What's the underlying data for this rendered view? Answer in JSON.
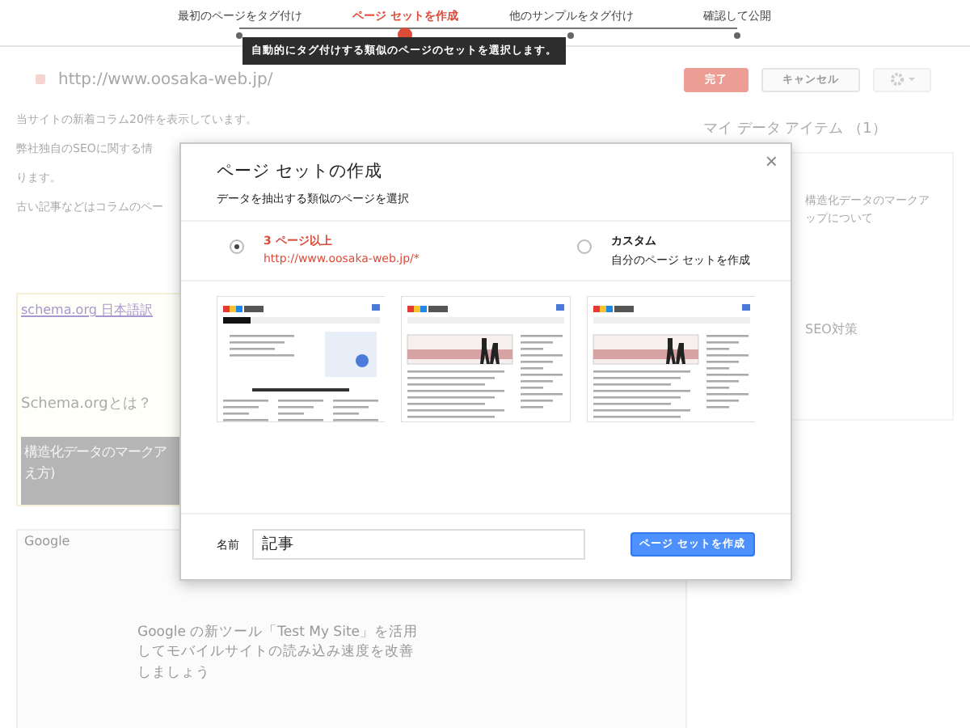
{
  "stepper": {
    "steps": [
      {
        "label": "最初のページをタグ付け",
        "selected": false
      },
      {
        "label": "ページ セットを作成",
        "selected": true
      },
      {
        "label": "他のサンプルをタグ付け",
        "selected": false
      },
      {
        "label": "確認して公開",
        "selected": false
      }
    ],
    "tooltip": "自動的にタグ付けする類似のページのセットを選択します。"
  },
  "header": {
    "url": "http://www.oosaka-web.jp/",
    "buttons": [
      "完了",
      "キャンセル"
    ]
  },
  "background": {
    "intro_lines": [
      "当サイトの新着コラム20件を表示しています。",
      "弊社独自のSEOに関する情",
      "ります。",
      "古い記事などはコラムのペー"
    ],
    "schema_card": {
      "link": "schema.org 日本語訳",
      "heading": "Schema.orgとは？",
      "band_lines": [
        "構造化データのマークア",
        "え方)"
      ]
    },
    "google_card": {
      "logo": "Google",
      "article": "Google の新ツール「Test My Site」を活用してモバイルサイトの読み込み速度を改善しましょう"
    },
    "sidebar": {
      "title": "マイ データ アイテム （1）",
      "item": "構造化データのマークアップについて",
      "tag": "SEO対策"
    }
  },
  "dialog": {
    "close": "×",
    "title": "ページ セットの作成",
    "subtitle": "データを抽出する類似のページを選択",
    "options": [
      {
        "title": "3 ページ以上",
        "detail": "http://www.oosaka-web.jp/*",
        "selected": true
      },
      {
        "title": "カスタム",
        "detail": "自分のページ セットを作成",
        "selected": false
      }
    ],
    "thumbnails": [
      {
        "kind": "home"
      },
      {
        "kind": "article"
      },
      {
        "kind": "article"
      }
    ],
    "name_label": "名前",
    "name_value": "記事",
    "submit": "ページ セットを作成"
  }
}
